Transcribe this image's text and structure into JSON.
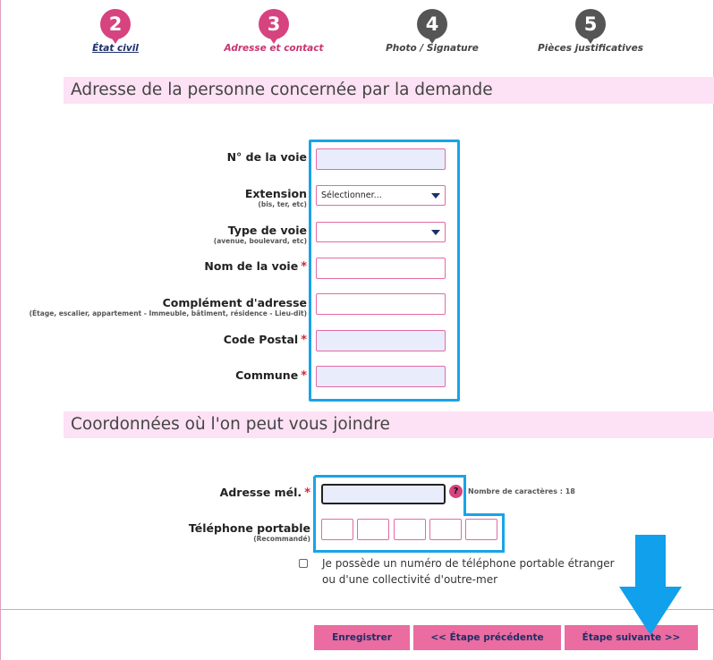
{
  "steps": [
    {
      "number": "2",
      "label": "État civil"
    },
    {
      "number": "3",
      "label": "Adresse et contact"
    },
    {
      "number": "4",
      "label": "Photo / Signature"
    },
    {
      "number": "5",
      "label": "Pièces justificatives"
    }
  ],
  "address_section": {
    "title": "Adresse de la personne concernée par la demande",
    "fields": {
      "numero": {
        "label": "N° de la voie"
      },
      "extension": {
        "label": "Extension",
        "hint": "(bis, ter, etc)",
        "selected": "Sélectionner..."
      },
      "type_voie": {
        "label": "Type de voie",
        "hint": "(avenue, boulevard, etc)",
        "selected": ""
      },
      "nom_voie": {
        "label": "Nom de la voie",
        "required": "*"
      },
      "complement": {
        "label": "Complément d'adresse",
        "hint": "(Étage, escalier, appartement - Immeuble, bâtiment, résidence - Lieu-dit)"
      },
      "code_postal": {
        "label": "Code Postal",
        "required": "*"
      },
      "commune": {
        "label": "Commune",
        "required": "*"
      }
    }
  },
  "contact_section": {
    "title": "Coordonnées où l'on peut vous joindre",
    "email": {
      "label": "Adresse mél.",
      "required": "*",
      "help": "?",
      "char_count": "Nombre de caractères : 18"
    },
    "phone": {
      "label": "Téléphone portable",
      "hint": "(Recommandé)"
    },
    "foreign_phone": {
      "line1": "Je possède un numéro de téléphone portable étranger",
      "line2": "ou d'une collectivité d'outre-mer"
    }
  },
  "buttons": {
    "save": "Enregistrer",
    "previous": "<< Étape précédente",
    "next": "Étape suivante >>"
  },
  "colors": {
    "accent_pink": "#d6437f",
    "section_bg": "#fde1f4",
    "highlight_blue": "#1aa3e8",
    "button_pink": "#ea6ca0"
  }
}
